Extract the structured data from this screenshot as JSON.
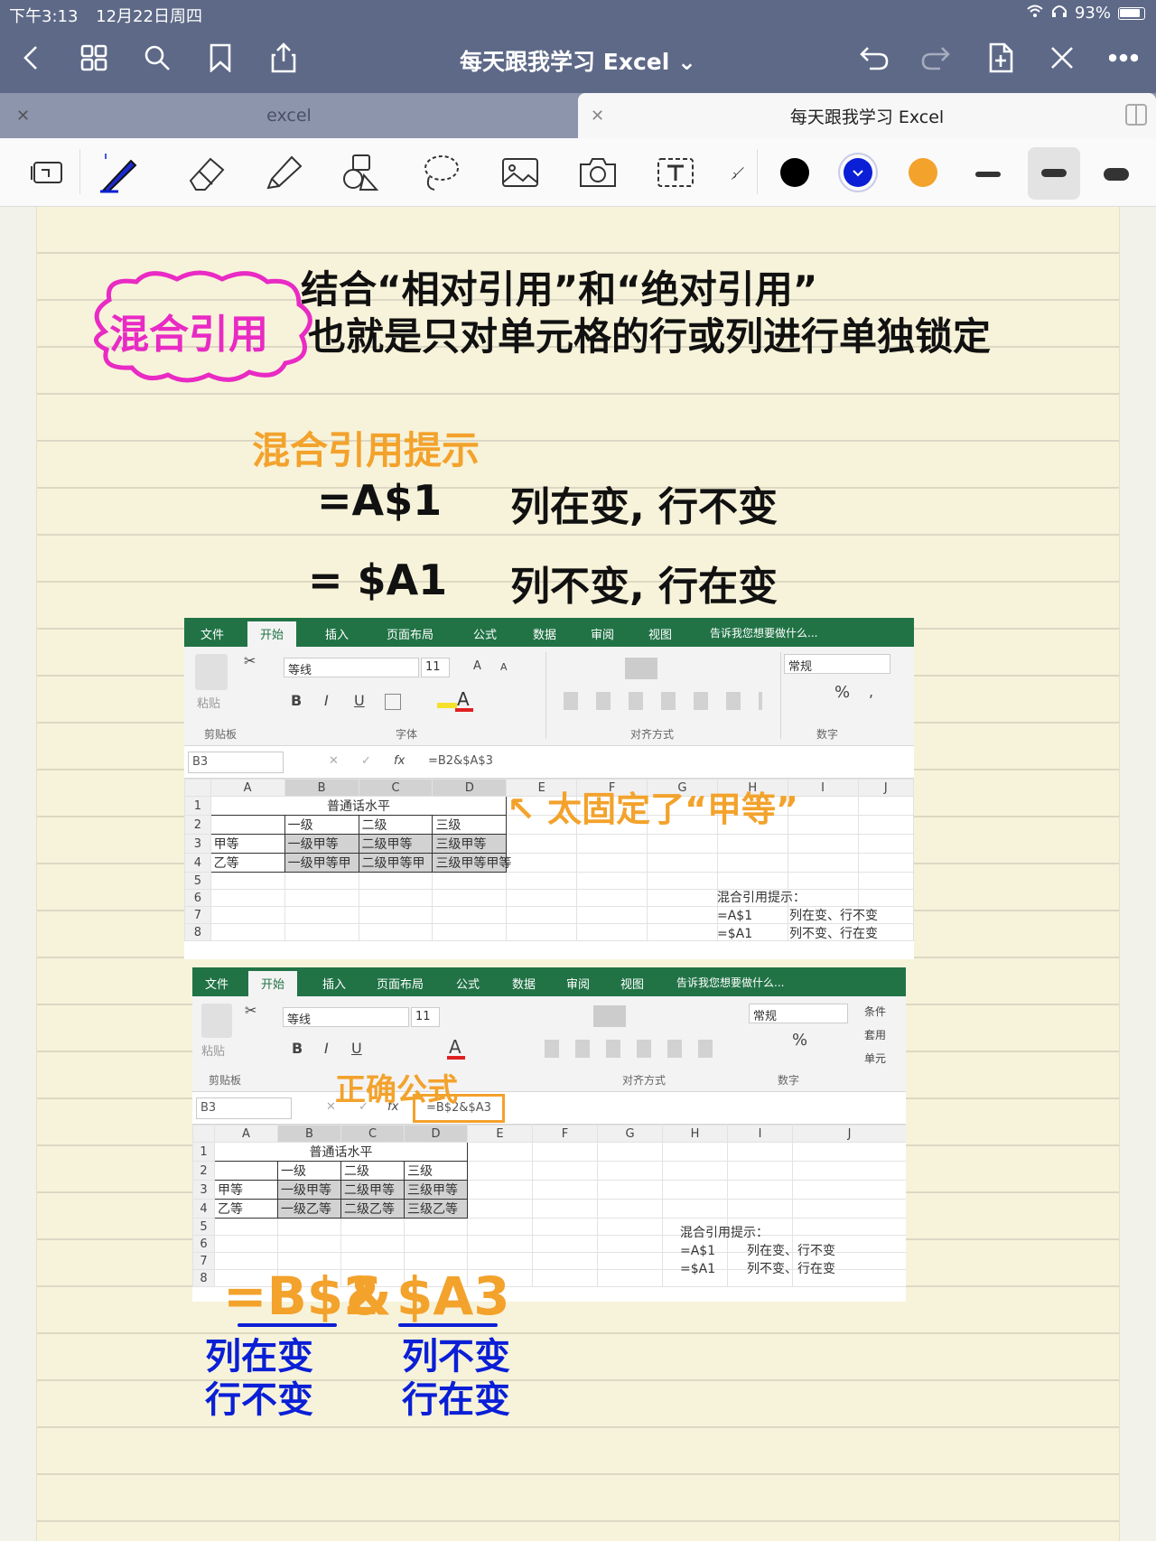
{
  "status_bar": {
    "time": "下午3:13",
    "date": "12月22日周四",
    "battery": "93%"
  },
  "title_bar": {
    "title": "每天跟我学习 Excel ⌄"
  },
  "tabs": [
    {
      "label": "excel"
    },
    {
      "label": "每天跟我学习 Excel"
    }
  ],
  "toolbar": {
    "tools": [
      "page-layout-icon",
      "pen-icon",
      "eraser-icon",
      "highlighter-icon",
      "shapes-icon",
      "lasso-icon",
      "image-icon",
      "camera-icon",
      "text-icon",
      "ruler-icon"
    ],
    "colors": [
      "#000000",
      "#0a1fd6",
      "#f3a22c"
    ]
  },
  "notes": {
    "cloud_title": "混合引用",
    "intro_line1": "结合“相对引用”和“绝对引用”",
    "intro_line2": "也就是只对单元格的行或列进行单独锁定",
    "tips_title": "混合引用提示",
    "tip1_formula": "=A$1",
    "tip1_desc": "列在变, 行不变",
    "tip2_formula": "= $A1",
    "tip2_desc": "列不变, 行在变",
    "arrow_note": "↖ 太固定了“甲等”",
    "correct_label": "正确公式",
    "big_formula_a": "=B$2",
    "big_formula_amp": "&",
    "big_formula_b": "$A3",
    "under_a1": "列在变",
    "under_a2": "行不变",
    "under_b1": "列不变",
    "under_b2": "行在变"
  },
  "excel": {
    "ribbon_tabs": [
      "文件",
      "开始",
      "插入",
      "页面布局",
      "公式",
      "数据",
      "审阅",
      "视图",
      "告诉我您想要做什么..."
    ],
    "font_name": "等线",
    "font_size": "11",
    "number_format": "常规",
    "groups": [
      "剪贴板",
      "字体",
      "对齐方式",
      "数字"
    ],
    "paste": "粘贴",
    "right_partial": [
      "条件",
      "套用",
      "单元"
    ],
    "col_headers": [
      "A",
      "B",
      "C",
      "D",
      "E",
      "F",
      "G",
      "H",
      "I",
      "J"
    ],
    "row_numbers": [
      "1",
      "2",
      "3",
      "4",
      "5",
      "6",
      "7",
      "8"
    ],
    "header_merged": "普通话水平",
    "levels": [
      "一级",
      "二级",
      "三级"
    ],
    "row3_label": "甲等",
    "row4_label": "乙等",
    "hint_title": "混合引用提示：",
    "hint_rows": [
      [
        "=A$1",
        "列在变、行不变"
      ],
      [
        "=$A1",
        "列不变、行在变"
      ]
    ],
    "shot1": {
      "name_box": "B3",
      "formula": "=B2&$A$3",
      "row3": [
        "一级甲等",
        "二级甲等",
        "三级甲等"
      ],
      "row4": [
        "一级甲等甲",
        "二级甲等甲",
        "三级甲等甲等"
      ]
    },
    "shot2": {
      "name_box": "B3",
      "formula": "=B$2&$A3",
      "row3": [
        "一级甲等",
        "二级甲等",
        "三级甲等"
      ],
      "row4": [
        "一级乙等",
        "二级乙等",
        "三级乙等"
      ]
    }
  }
}
